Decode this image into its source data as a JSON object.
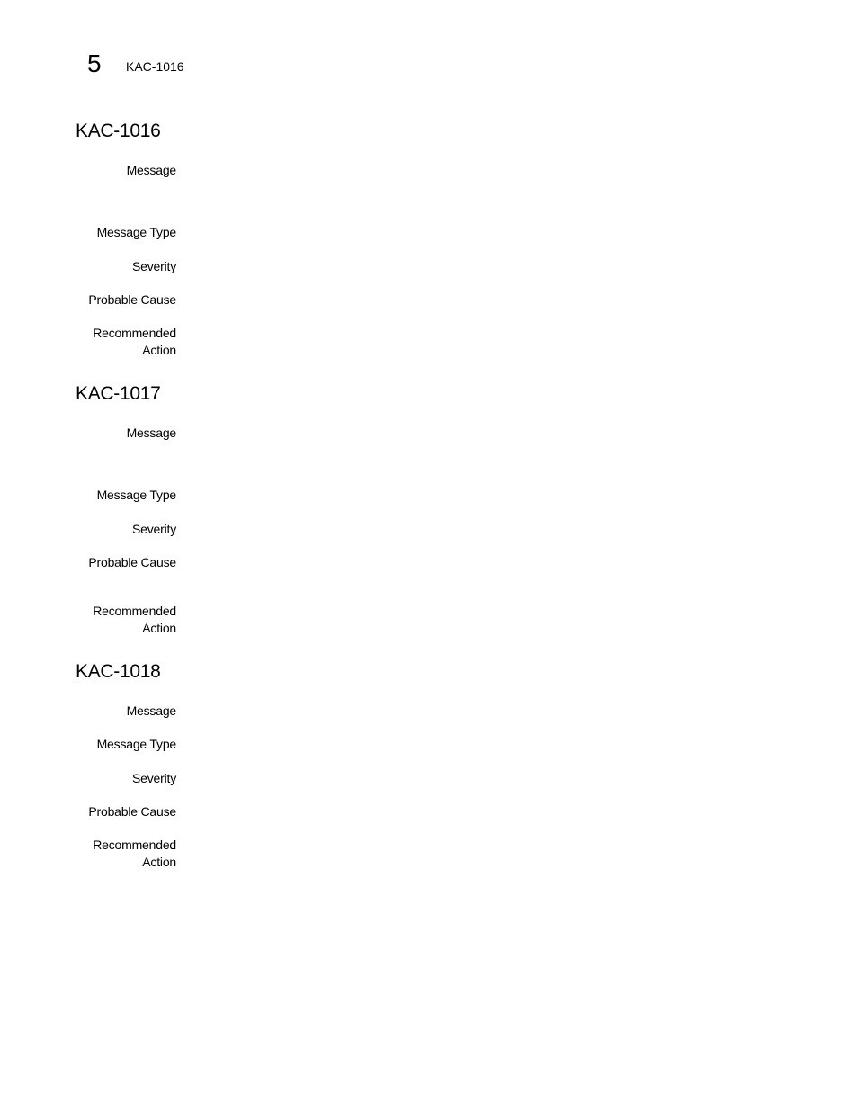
{
  "header": {
    "chapter_number": "5",
    "running_title": "KAC-1016"
  },
  "entries": [
    {
      "title": "KAC-1016",
      "labels": {
        "message": "Message",
        "message_type": "Message Type",
        "severity": "Severity",
        "probable_cause": "Probable Cause",
        "recommended_action_line1": "Recommended",
        "recommended_action_line2": "Action"
      }
    },
    {
      "title": "KAC-1017",
      "labels": {
        "message": "Message",
        "message_type": "Message Type",
        "severity": "Severity",
        "probable_cause": "Probable Cause",
        "recommended_action_line1": "Recommended",
        "recommended_action_line2": "Action"
      }
    },
    {
      "title": "KAC-1018",
      "labels": {
        "message": "Message",
        "message_type": "Message Type",
        "severity": "Severity",
        "probable_cause": "Probable Cause",
        "recommended_action_line1": "Recommended",
        "recommended_action_line2": "Action"
      }
    }
  ]
}
